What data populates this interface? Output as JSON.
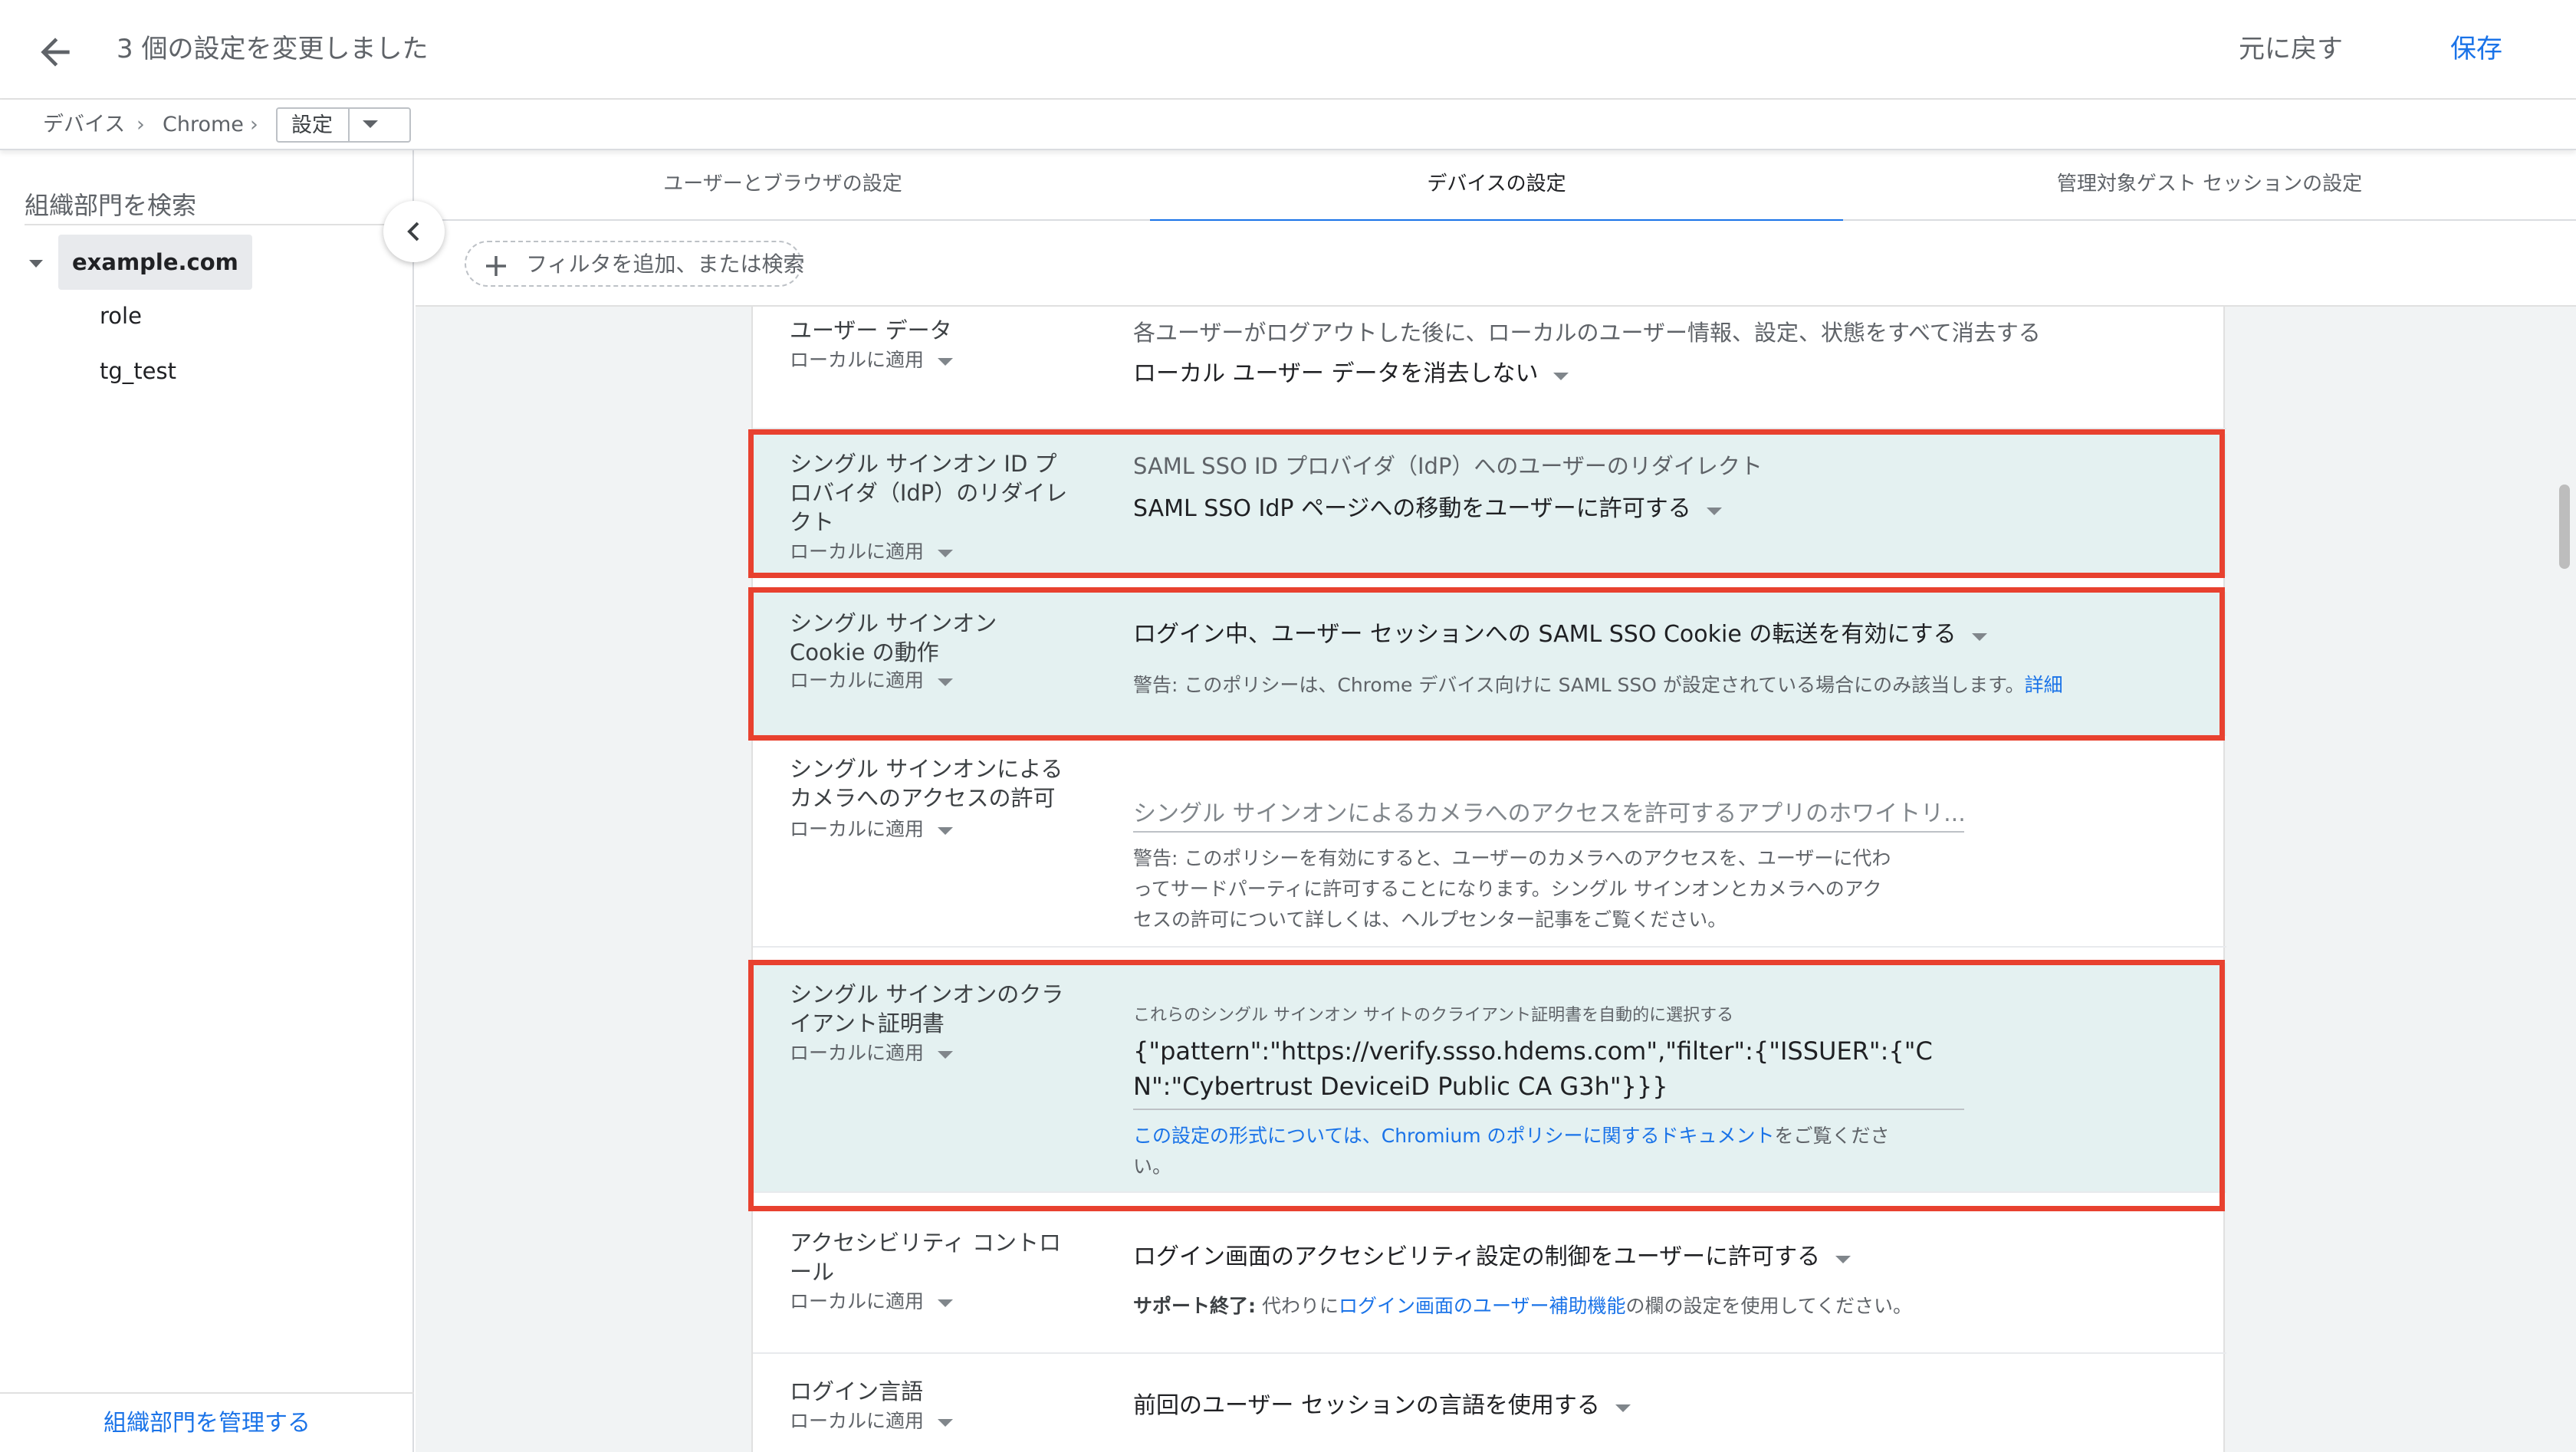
{
  "header": {
    "title": "3 個の設定を変更しました",
    "undo_label": "元に戻す",
    "save_label": "保存"
  },
  "breadcrumb": {
    "items": [
      "デバイス",
      "Chrome"
    ],
    "current": "設定"
  },
  "sidebar": {
    "search_placeholder": "組織部門を検索",
    "root": "example.com",
    "children": [
      "role",
      "tg_test"
    ],
    "manage_label": "組織部門を管理する"
  },
  "tabs": [
    {
      "label": "ユーザーとブラウザの設定"
    },
    {
      "label": "デバイスの設定"
    },
    {
      "label": "管理対象ゲスト セッションの設定"
    }
  ],
  "filter": {
    "label": "フィルタを追加、または検索"
  },
  "settings": [
    {
      "name": "ユーザー データ",
      "applies": "ローカルに適用",
      "description": "各ユーザーがログアウトした後に、ローカルのユーザー情報、設定、状態をすべて消去する",
      "value": "ローカル ユーザー データを消去しない"
    },
    {
      "name": "シングル サインオン ID プロバイダ（IdP）のリダイレクト",
      "applies": "ローカルに適用",
      "description": "SAML SSO ID プロバイダ（IdP）へのユーザーのリダイレクト",
      "value": "SAML SSO IdP ページへの移動をユーザーに許可する"
    },
    {
      "name": "シングル サインオン Cookie の動作",
      "applies": "ローカルに適用",
      "value": "ログイン中、ユーザー セッションへの SAML SSO Cookie の転送を有効にする",
      "note": "警告: このポリシーは、Chrome デバイス向けに SAML SSO が設定されている場合にのみ該当します。",
      "note_link": "詳細"
    },
    {
      "name": "シングル サインオンによるカメラへのアクセスの許可",
      "applies": "ローカルに適用",
      "placeholder": "シングル サインオンによるカメラへのアクセスを許可するアプリのホワイトリ...",
      "note": "警告: このポリシーを有効にすると、ユーザーのカメラへのアクセスを、ユーザーに代わってサードパーティに許可することになります。シングル サインオンとカメラへのアクセスの許可について詳しくは、ヘルプセンター記事をご覧ください。"
    },
    {
      "name": "シングル サインオンのクライアント証明書",
      "applies": "ローカルに適用",
      "label": "これらのシングル サインオン サイトのクライアント証明書を自動的に選択する",
      "value": "{\"pattern\":\"https://verify.ssso.hdems.com\",\"filter\":{\"ISSUER\":{\"CN\":\"Cybertrust DeviceiD Public CA G3h\"}}}",
      "note_link": "この設定の形式については、Chromium のポリシーに関するドキュメント",
      "note_suffix": "をご覧ください。"
    },
    {
      "name": "アクセシビリティ コントロール",
      "applies": "ローカルに適用",
      "value": "ログイン画面のアクセシビリティ設定の制御をユーザーに許可する",
      "note_bold": "サポート終了:",
      "note_prefix": " 代わりに",
      "note_link": "ログイン画面のユーザー補助機能",
      "note_suffix": "の欄の設定を使用してください。"
    },
    {
      "name": "ログイン言語",
      "applies": "ローカルに適用",
      "value": "前回のユーザー セッションの言語を使用する"
    }
  ],
  "colors": {
    "accent": "#1a73e8",
    "highlight_bg": "#e4f1f1",
    "highlight_border": "#e8412f"
  },
  "icons": [
    "back-arrow-icon",
    "chevron-right-icon",
    "dropdown-arrow-icon",
    "collapse-chevron-left-icon",
    "plus-icon",
    "tree-expand-icon"
  ]
}
